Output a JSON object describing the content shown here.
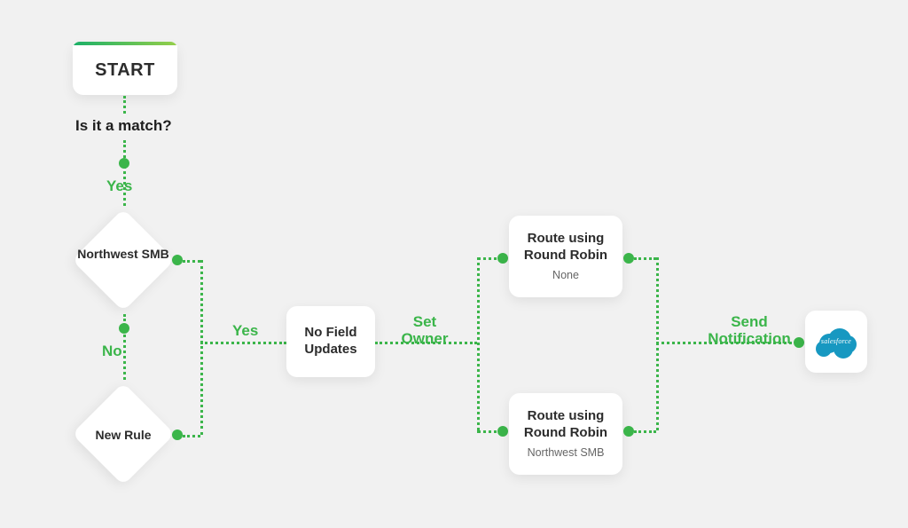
{
  "start": {
    "label": "START"
  },
  "question": "Is it a match?",
  "labels": {
    "yes_top": "Yes",
    "no": "No",
    "yes_mid": "Yes",
    "set_owner": "Set Owner",
    "send_notification": "Send Notification"
  },
  "diamonds": {
    "top": {
      "label": "Northwest SMB"
    },
    "bottom": {
      "label": "New Rule"
    }
  },
  "nodes": {
    "field_updates": {
      "title": "No Field Updates"
    },
    "route_top": {
      "title": "Route using Round Robin",
      "sub": "None"
    },
    "route_bottom": {
      "title": "Route using Round Robin",
      "sub": "Northwest SMB"
    },
    "salesforce": {
      "title": "salesforce"
    }
  }
}
